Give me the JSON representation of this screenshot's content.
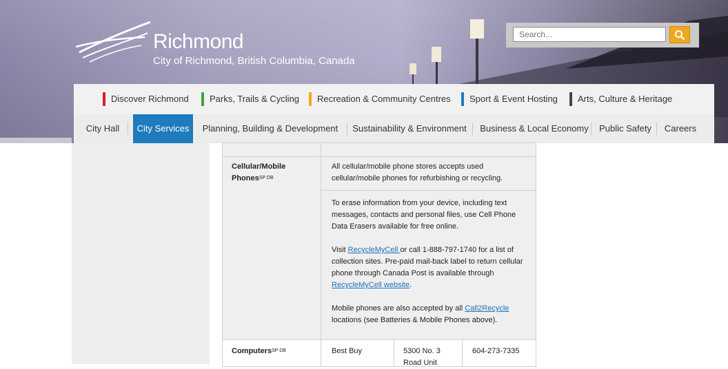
{
  "header": {
    "logo_name": "Richmond",
    "logo_subtitle": "City of Richmond, British Columbia, Canada",
    "search_placeholder": "Search..."
  },
  "nav_primary": [
    {
      "label": "Discover Richmond",
      "color": "#d32027"
    },
    {
      "label": "Parks, Trails & Cycling",
      "color": "#3aa43a"
    },
    {
      "label": "Recreation & Community Centres",
      "color": "#f5a623"
    },
    {
      "label": "Sport & Event Hosting",
      "color": "#1e7bbd"
    },
    {
      "label": "Arts, Culture & Heritage",
      "color": "#444444"
    }
  ],
  "nav_secondary": [
    {
      "label": "City Hall",
      "active": false
    },
    {
      "label": "City Services",
      "active": true
    },
    {
      "label": "Planning, Building & Development",
      "active": false
    },
    {
      "label": "Sustainability & Environment",
      "active": false
    },
    {
      "label": "Business & Local Economy",
      "active": false
    },
    {
      "label": "Public Safety",
      "active": false
    },
    {
      "label": "Careers",
      "active": false
    }
  ],
  "table": {
    "cellular": {
      "item": "Cellular/Mobile Phones",
      "sup": "SP DB",
      "row1": "All cellular/mobile phone stores accepts used cellular/mobile phones for refurbishing or recycling.",
      "erase": "To erase information from your device, including text messages, contacts and personal files, use Cell Phone Data Erasers available for free online.",
      "visit_prefix": "Visit ",
      "visit_link": "RecycleMyCell ",
      "visit_suffix": "or call 1-888-797-1740 for a list of collection sites. Pre-paid mail-back label to return cellular phone through Canada Post is available through ",
      "website_link": "RecycleMyCell website",
      "website_suffix": ".",
      "mobile_prefix": "Mobile phones are also accepted by all ",
      "mobile_link": "Call2Recycle",
      "mobile_suffix": " locations (see Batteries & Mobile Phones above)."
    },
    "computers": {
      "item": "Computers",
      "sup": "SP DB",
      "location": "Best Buy",
      "address": "5300 No. 3 Road Unit",
      "phone": "604-273-7335"
    }
  }
}
